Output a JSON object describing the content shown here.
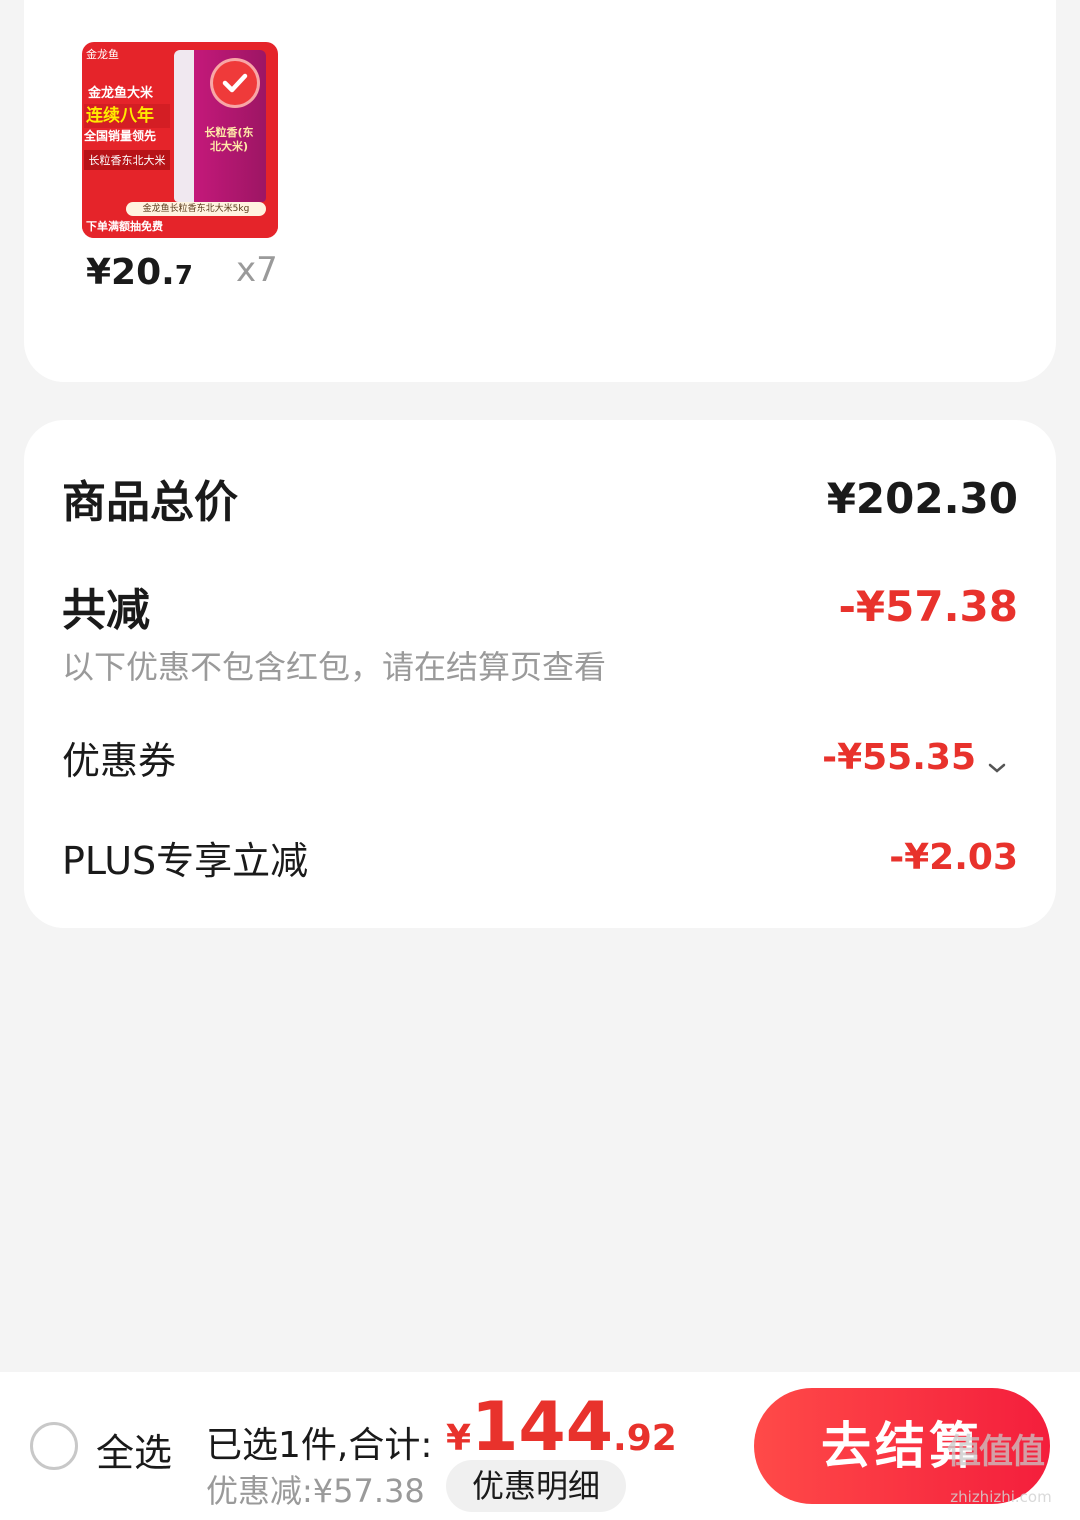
{
  "product": {
    "image": {
      "brand": "金龙鱼",
      "name": "金龙鱼大米",
      "slogan": "连续八年",
      "slogan_sub": "全国销量领先",
      "rice_type": "长粒香东北大米",
      "bag_label": "长粒香(东北大米)",
      "spec": "金龙鱼长粒香东北大米5kg",
      "promo": "下单满额抽免费"
    },
    "price_int": "¥20.",
    "price_dec": "7",
    "quantity": "x7"
  },
  "summary": {
    "total_label": "商品总价",
    "total_value": "¥202.30",
    "discount_label": "共减",
    "discount_value": "-¥57.38",
    "discount_note": "以下优惠不包含红包，请在结算页查看",
    "items": [
      {
        "label": "优惠券",
        "value": "-¥55.35"
      },
      {
        "label": "PLUS专享立减",
        "value": "-¥2.03"
      }
    ]
  },
  "bottom_bar": {
    "select_all_label": "全选",
    "selected_text": "已选1件,合计:",
    "grand_total_currency": "¥",
    "grand_total_int": "144",
    "grand_total_dec": ".92",
    "saved_text": "优惠减:¥57.38",
    "detail_label": "优惠明细",
    "checkout_label": "去结算"
  },
  "watermark": {
    "text": "值值值",
    "url": "zhizhizhi.com"
  },
  "colors": {
    "accent_red": "#e8322c",
    "checkout_gradient_start": "#ff4a48",
    "checkout_gradient_end": "#f41e3c",
    "background": "#f4f4f4"
  }
}
